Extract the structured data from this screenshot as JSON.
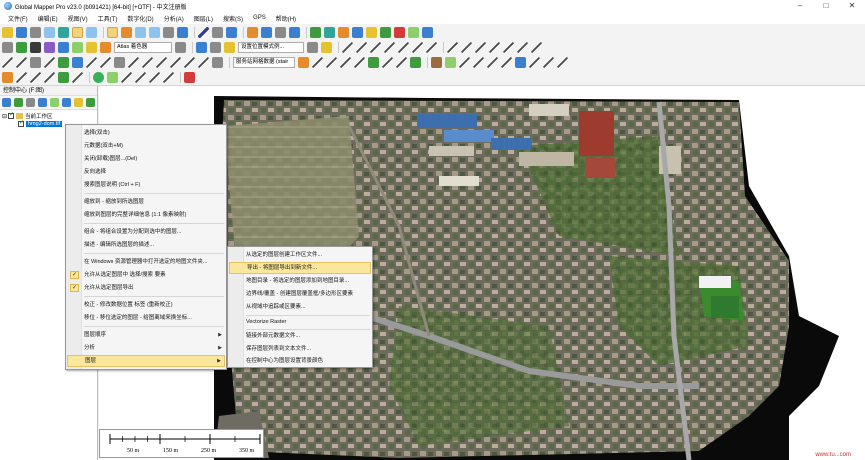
{
  "window": {
    "title": "Global Mapper Pro v23.0 (b091421) [64-bit] [+OTF] - 中文注册版"
  },
  "menubar": [
    "文件(F)",
    "编辑(E)",
    "视图(V)",
    "工具(T)",
    "数字化(D)",
    "分析(A)",
    "图层(L)",
    "搜索(S)",
    "GPS",
    "帮助(H)"
  ],
  "toolbar": {
    "row2_combo1": "Atlas 着色器",
    "row2_combo2": "设置位置模式例...",
    "row4_combo": "服务站网格数据 (stair"
  },
  "panel": {
    "title": "控制中心 (F:图)",
    "root_label": "当前工作区",
    "layer_label": "hmg2-dom.tif"
  },
  "context_menu": {
    "items": [
      "选择(双击)",
      "元数据(双击+M)",
      "关闭(卸载)图层...(Del)",
      "反向选择",
      "搜索图层说明 (Ctrl + F)",
      "缩放到 - 缩放到所选图层",
      "缩放到图层的完整详细信息 (1:1 像素映射)",
      "组合 - 将组合设置为分配到选中的图层...",
      "描述 - 编辑所选图层的描述...",
      "在 Windows 资源管理器中打开选定的地图文件夹...",
      "允许从选定图层中 选择/搜索 要素",
      "允许从选定图层导出",
      "校正 - 修改数据位置 标签 (重新校正)",
      "移位 - 移位选定的图层 - 给图离域来换坐标...",
      "图层顺序",
      "分析",
      "图层"
    ],
    "submenu_items": [
      "从选定的图层创建工作区文件...",
      "导出 - 将图层导出到新文件...",
      "地图目录 - 将选定的图层添加到地图目录...",
      "边界线/覆盖 - 创建图层覆盖框/多边形区要素",
      "从视域中追踪或区要素...",
      "Vectorize Raster",
      "链接外部元数据文件...",
      "保存图层列表到文本文件...",
      "在控制中心为图层设置背景颜色"
    ]
  },
  "scale": {
    "labels": [
      "50 m",
      "150 m",
      "250 m",
      "350 m"
    ]
  },
  "watermark": "www.tu...com"
}
